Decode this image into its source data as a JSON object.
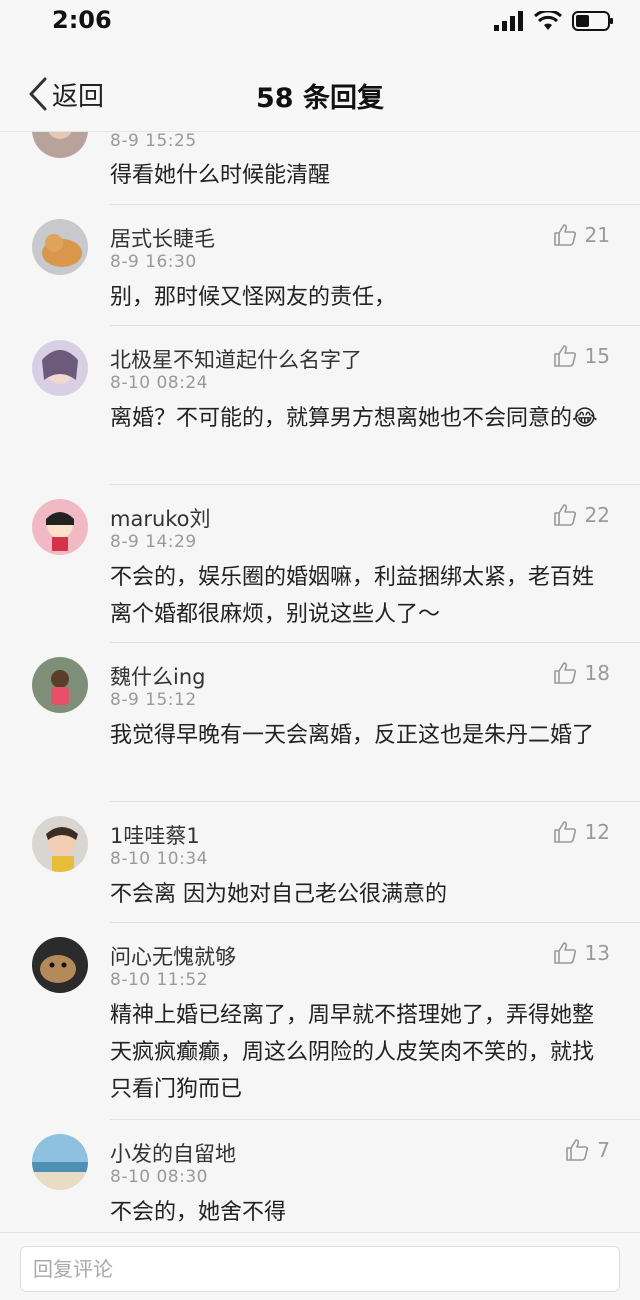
{
  "status_bar": {
    "time": "2:06"
  },
  "nav": {
    "back_label": "返回",
    "title": "58 条回复"
  },
  "comments": [
    {
      "username": "",
      "time": "8-9 15:25",
      "content": "得看她什么时候能清醒",
      "likes": ""
    },
    {
      "username": "居式长睫毛",
      "time": "8-9 16:30",
      "content": "别，那时候又怪网友的责任，",
      "likes": "21"
    },
    {
      "username": "北极星不知道起什么名字了",
      "time": "8-10 08:24",
      "content": "离婚？不可能的，就算男方想离她也不会同意的😂",
      "likes": "15"
    },
    {
      "username": "maruko刘",
      "time": "8-9 14:29",
      "content": "不会的，娱乐圈的婚姻嘛，利益捆绑太紧，老百姓离个婚都很麻烦，别说这些人了～",
      "likes": "22"
    },
    {
      "username": "魏什么ing",
      "time": "8-9 15:12",
      "content": "我觉得早晚有一天会离婚，反正这也是朱丹二婚了",
      "likes": "18"
    },
    {
      "username": "1哇哇蔡1",
      "time": "8-10 10:34",
      "content": "不会离 因为她对自己老公很满意的",
      "likes": "12"
    },
    {
      "username": "问心无愧就够",
      "time": "8-10 11:52",
      "content": "精神上婚已经离了，周早就不搭理她了，弄得她整天疯疯癫癫，周这么阴险的人皮笑肉不笑的，就找只看门狗而已",
      "likes": "13"
    },
    {
      "username": "小发的自留地",
      "time": "8-10 08:30",
      "content": "不会的，她舍不得",
      "likes": "7"
    }
  ],
  "reply_bar": {
    "placeholder": "回复评论"
  },
  "icons": {
    "back": "chevron-left-icon",
    "like": "thumbs-up-icon",
    "signal": "signal-icon",
    "wifi": "wifi-icon",
    "battery": "battery-icon"
  }
}
